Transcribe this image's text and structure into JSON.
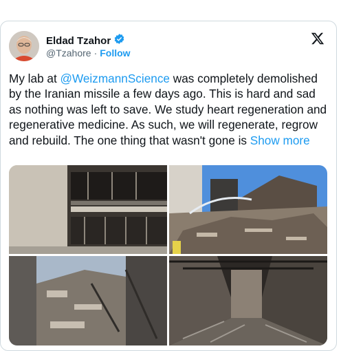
{
  "author": {
    "name": "Eldad Tzahor",
    "handle": "@Tzahore",
    "follow_label": "Follow",
    "verified": true
  },
  "tweet": {
    "intro": "My lab at ",
    "mention": "@WeizmannScience",
    "body": " was completely demolished by the Iranian missile a few days ago. This is hard and sad as nothing was left to save. We study heart regeneration and regenerative medicine. As such, we will regenerate, regrow and rebuild. The one thing that wasn't gone is ",
    "show_more": "Show more"
  },
  "icons": {
    "verified": "verified-badge-icon",
    "platform": "x-logo-icon"
  },
  "colors": {
    "accent": "#1d9bf0",
    "text": "#0f1419",
    "muted": "#536471",
    "border": "#cfd9de"
  }
}
